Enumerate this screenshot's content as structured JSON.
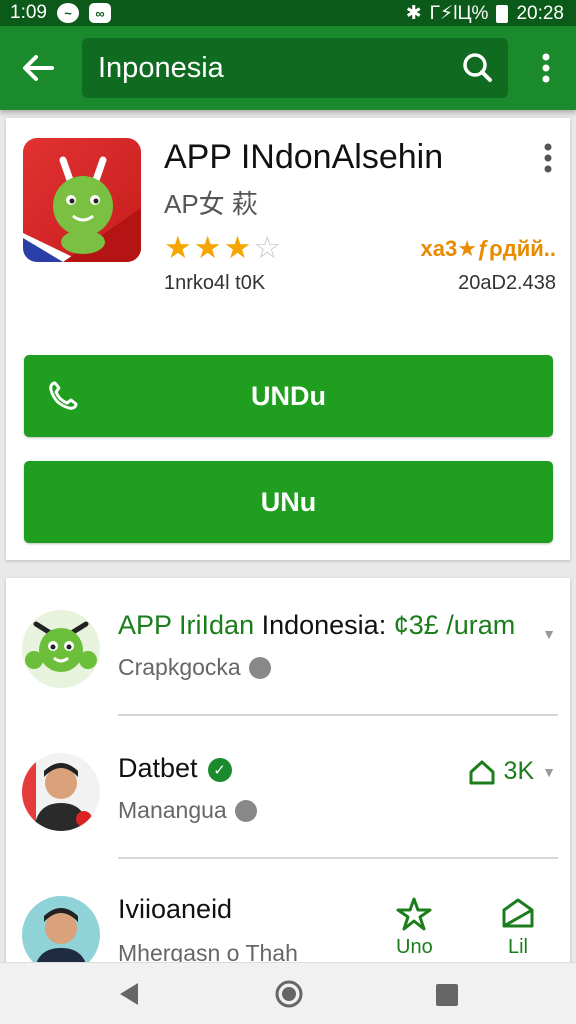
{
  "status": {
    "time_left": "1:09",
    "right_text": "Г⚡lЦ%",
    "clock": "20:28"
  },
  "appbar": {
    "search_value": "Inponesia"
  },
  "app": {
    "title": "APP INdonAlsehin",
    "subtitle": "AP女 萩",
    "rating_stars": 3,
    "rating_stars_max": 4,
    "rating_text": "ха3★ƒρдйй..",
    "installs": "1nrko4l t0K",
    "size": "20aD2.438",
    "button1": "UNDu",
    "button2": "UNu"
  },
  "list": [
    {
      "title_green": "APP IriIdan",
      "title_rest": " Indonesia: ",
      "title_tail": "¢3£ /uram",
      "subtitle": "Crapkgocka"
    },
    {
      "title": "Datbet",
      "subtitle": "Manangua",
      "meta_value": "3K"
    },
    {
      "title": "Iviioaneid",
      "subtitle": "Mhergasn o Thah",
      "action1": "Uno",
      "action2": "Lil"
    }
  ],
  "colors": {
    "appbar": "#1b8a2c",
    "statusbar": "#0c5a19",
    "button": "#1f9e1f",
    "star": "#f4a500"
  }
}
